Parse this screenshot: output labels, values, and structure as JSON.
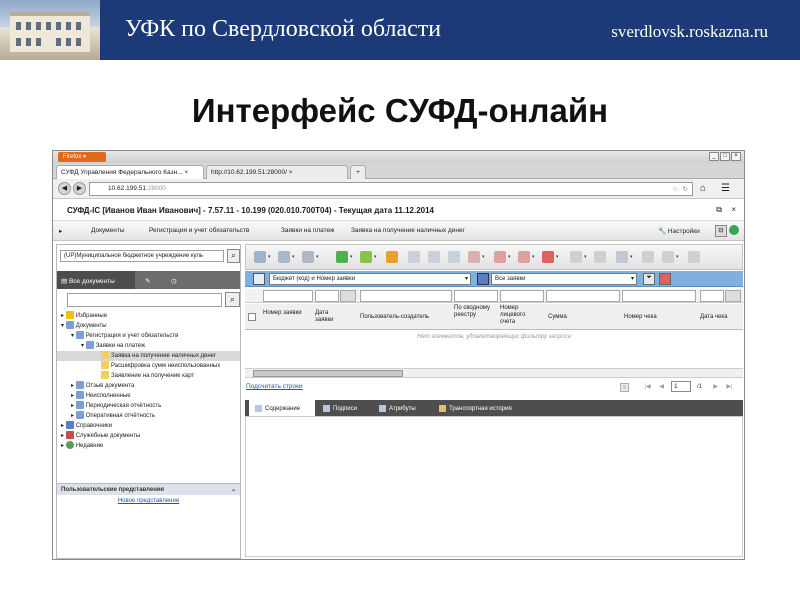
{
  "slide": {
    "org_title": "УФК по Свердловской области",
    "site": "sverdlovsk.roskazna.ru",
    "title": "Интерфейс СУФД-онлайн"
  },
  "browser": {
    "menu_button": "Firefox",
    "tabs": [
      {
        "label": "СУФД Управления Федерального Казн..."
      },
      {
        "label": "http://10.62.199.51:28000/"
      }
    ],
    "new_tab": "+",
    "url_host": "10.62.199.51",
    "url_port": ":28000",
    "win_controls": [
      "_",
      "□",
      "×"
    ]
  },
  "app": {
    "title": "СУФД-IC [Иванов Иван Иванович] - 7.57.11 - 10.199 (020.010.700T04) - Текущая дата 11.12.2014",
    "menu": [
      "Документы",
      "Регистрация и учет обязательств",
      "Заявки на платеж",
      "Заявка на получение наличных денег"
    ],
    "settings": "Настройки"
  },
  "left": {
    "org_select": "(UP)Муниципальное бюджетное учреждение куль",
    "tabs": [
      "Все документы"
    ],
    "tree": [
      {
        "label": "Избранные"
      },
      {
        "label": "Документы"
      },
      {
        "label": "Регистрация и учет обязательств"
      },
      {
        "label": "Заявки на платеж"
      },
      {
        "label": "Заявка на получение наличных денег"
      },
      {
        "label": "Расшифровка сумм неиспользованных"
      },
      {
        "label": "Заявление на получение карт"
      },
      {
        "label": "Отзыв документа"
      },
      {
        "label": "Неисполненные"
      },
      {
        "label": "Периодическая отчётность"
      },
      {
        "label": "Оперативная отчётность"
      },
      {
        "label": "Справочники"
      },
      {
        "label": "Служебные документы"
      },
      {
        "label": "Недавние"
      }
    ],
    "user_views_header": "Пользовательские представления",
    "new_view": "Новое представление"
  },
  "right": {
    "filter1": "Бюджет (код) и Номер заявки",
    "filter2": "Все заявки",
    "columns": [
      "Номер заявки",
      "Дата заявки",
      "Пользователь-создатель",
      "По сводному реестру",
      "Номер лицевого счета",
      "Сумма",
      "Номер чека",
      "Дата чека"
    ],
    "empty_message": "Нет элементов, удовлетворяющих фильтру запроса",
    "pager_link": "Подсчитать строки",
    "page": "1",
    "page_total": "/1",
    "bottom_tabs": [
      "Содержание",
      "Подписи",
      "Атрибуты",
      "Транспортная история"
    ]
  }
}
